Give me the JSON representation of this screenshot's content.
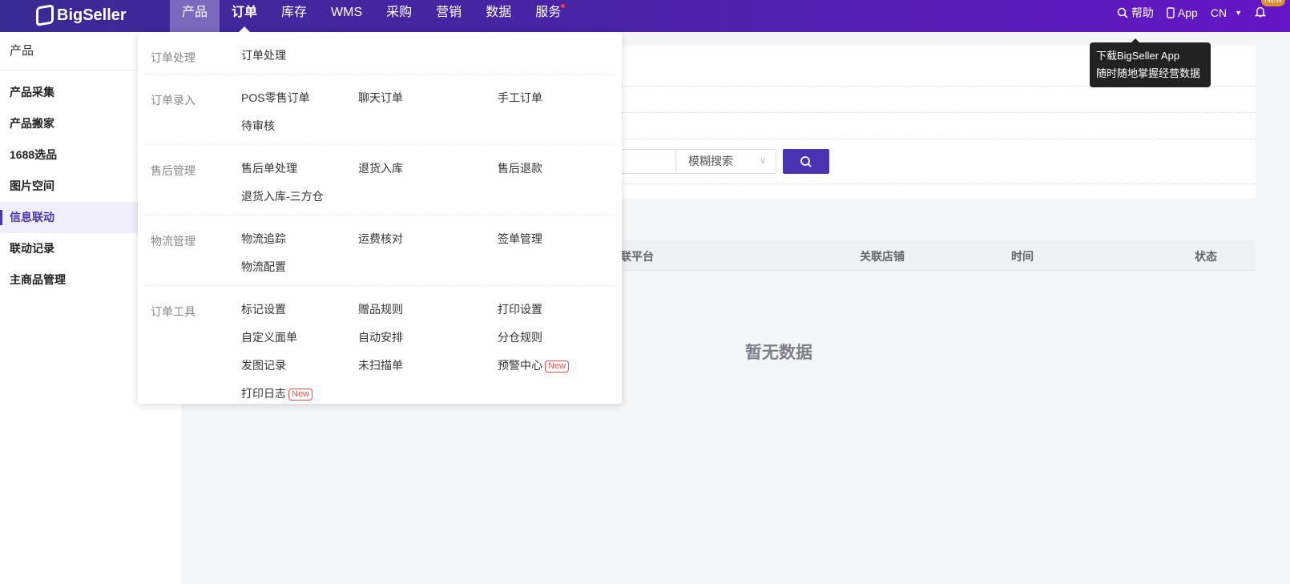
{
  "brand": {
    "name": "BigSeller"
  },
  "nav": {
    "items": [
      {
        "label": "产品"
      },
      {
        "label": "订单"
      },
      {
        "label": "库存"
      },
      {
        "label": "WMS"
      },
      {
        "label": "采购"
      },
      {
        "label": "营销"
      },
      {
        "label": "数据"
      },
      {
        "label": "服务"
      }
    ]
  },
  "tools": {
    "help": "帮助",
    "app": "App",
    "lang": "CN",
    "new_badge": "New"
  },
  "tooltip": {
    "line1": "下载BigSeller App",
    "line2": "随时随地掌握经营数据"
  },
  "sidebar": {
    "title": "产品",
    "items": [
      {
        "label": "产品采集"
      },
      {
        "label": "产品搬家"
      },
      {
        "label": "1688选品"
      },
      {
        "label": "图片空间"
      },
      {
        "label": "信息联动"
      },
      {
        "label": "联动记录"
      },
      {
        "label": "主商品管理"
      }
    ]
  },
  "search": {
    "mode": "模糊搜索"
  },
  "table": {
    "headers": [
      "联平台",
      "关联店铺",
      "时间",
      "状态"
    ],
    "empty": "暂无数据"
  },
  "menu": {
    "groups": [
      {
        "label": "订单处理",
        "items": [
          {
            "label": "订单处理"
          }
        ]
      },
      {
        "label": "订单录入",
        "items": [
          {
            "label": "POS零售订单"
          },
          {
            "label": "聊天订单"
          },
          {
            "label": "手工订单"
          },
          {
            "label": "待审核"
          }
        ]
      },
      {
        "label": "售后管理",
        "items": [
          {
            "label": "售后单处理"
          },
          {
            "label": "退货入库"
          },
          {
            "label": "售后退款"
          },
          {
            "label": "退货入库-三方仓"
          }
        ]
      },
      {
        "label": "物流管理",
        "items": [
          {
            "label": "物流追踪"
          },
          {
            "label": "运费核对"
          },
          {
            "label": "签单管理"
          },
          {
            "label": "物流配置"
          }
        ]
      },
      {
        "label": "订单工具",
        "items": [
          {
            "label": "标记设置"
          },
          {
            "label": "赠品规则"
          },
          {
            "label": "打印设置"
          },
          {
            "label": "自定义面单"
          },
          {
            "label": "自动安排"
          },
          {
            "label": "分仓规则"
          },
          {
            "label": "发图记录"
          },
          {
            "label": "未扫描单"
          },
          {
            "label": "预警中心",
            "badge": "New"
          },
          {
            "label": "打印日志",
            "badge": "New"
          }
        ]
      }
    ]
  },
  "colors": {
    "accent": "#4a33b0",
    "nav_active": "#7a69bd",
    "badge_red": "#f05050",
    "badge_orange": "#e0912f"
  }
}
